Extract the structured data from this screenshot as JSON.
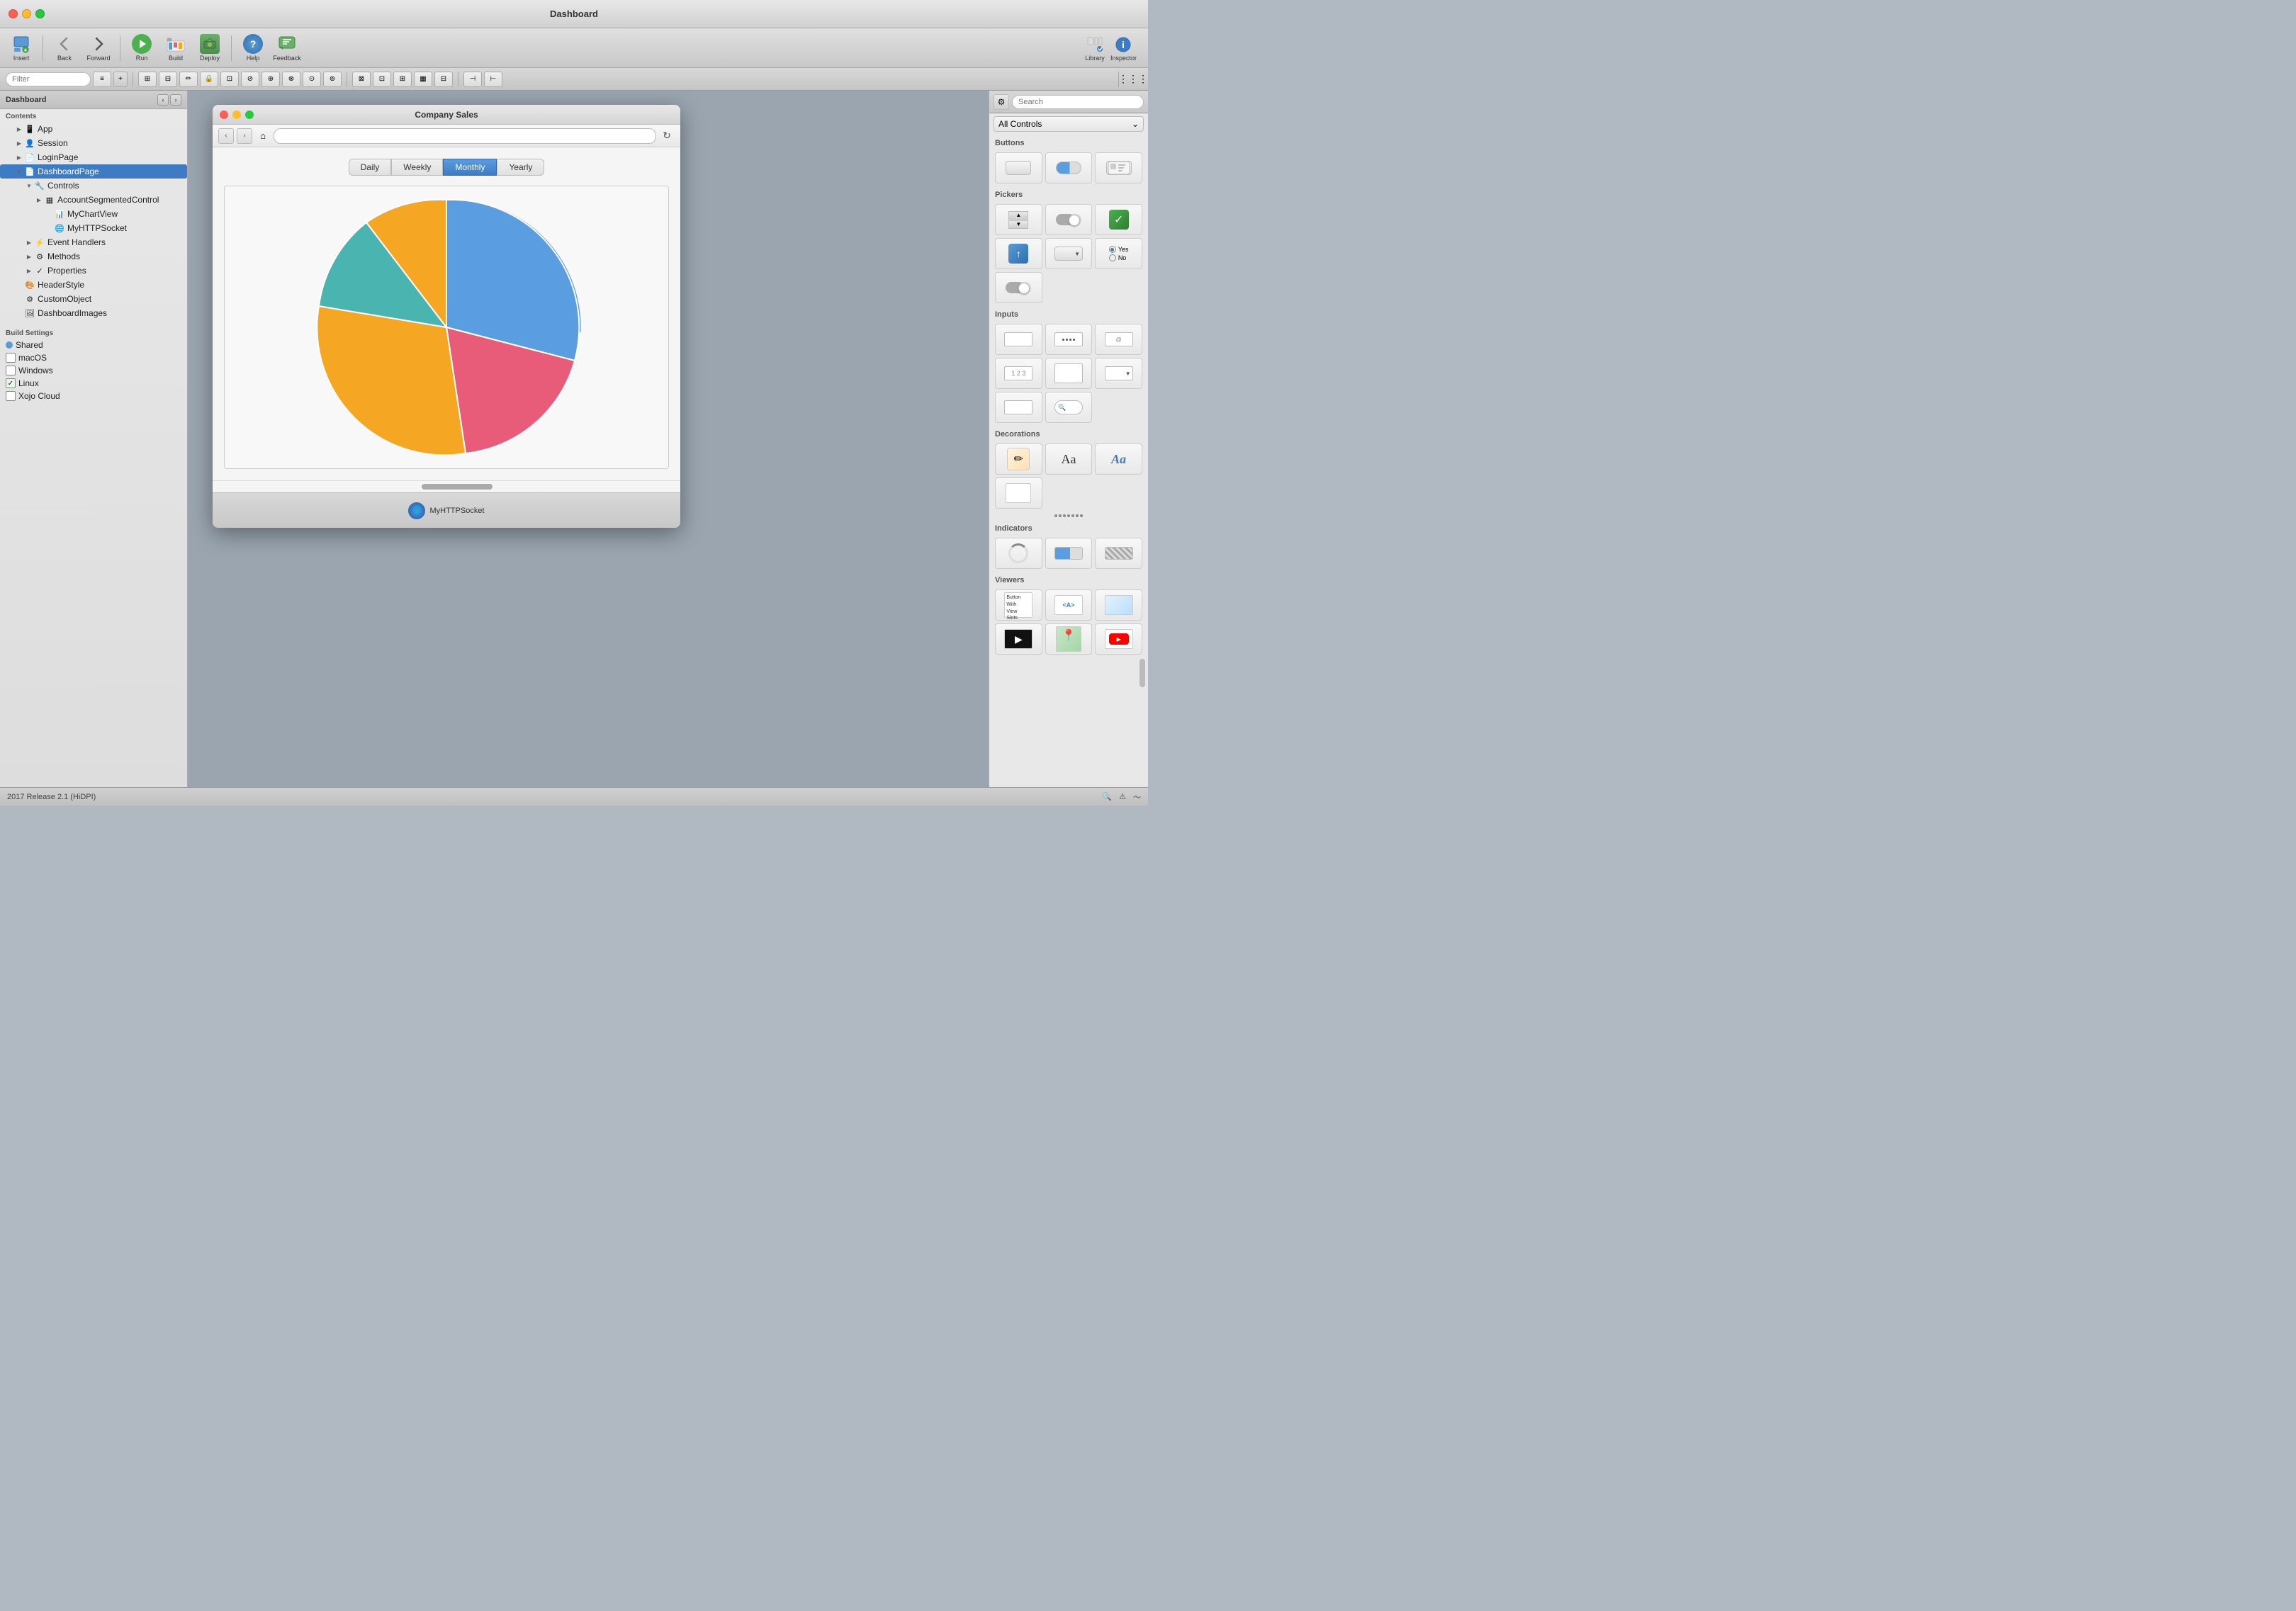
{
  "window": {
    "title": "Dashboard",
    "app_title": "Company Sales"
  },
  "toolbar": {
    "insert_label": "Insert",
    "back_label": "Back",
    "forward_label": "Forward",
    "run_label": "Run",
    "build_label": "Build",
    "deploy_label": "Deploy",
    "help_label": "Help",
    "feedback_label": "Feedback",
    "library_label": "Library",
    "inspector_label": "Inspector"
  },
  "filter": {
    "placeholder": "Filter"
  },
  "sidebar": {
    "project_name": "Dashboard",
    "section_contents": "Contents",
    "items": [
      {
        "label": "App",
        "icon": "📱",
        "indent": "indent1",
        "toggle": "closed"
      },
      {
        "label": "Session",
        "icon": "👤",
        "indent": "indent1",
        "toggle": "closed"
      },
      {
        "label": "LoginPage",
        "icon": "📄",
        "indent": "indent1",
        "toggle": "closed"
      },
      {
        "label": "DashboardPage",
        "icon": "📄",
        "indent": "indent1",
        "toggle": "open",
        "selected": true
      },
      {
        "label": "Controls",
        "icon": "🔧",
        "indent": "indent2",
        "toggle": "open"
      },
      {
        "label": "AccountSegmentedControl",
        "icon": "▦",
        "indent": "indent3",
        "toggle": "closed"
      },
      {
        "label": "MyChartView",
        "icon": "📊",
        "indent": "indent4",
        "toggle": "empty"
      },
      {
        "label": "MyHTTPSocket",
        "icon": "🌐",
        "indent": "indent4",
        "toggle": "empty"
      },
      {
        "label": "Event Handlers",
        "icon": "⚡",
        "indent": "indent2",
        "toggle": "closed"
      },
      {
        "label": "Methods",
        "icon": "⚙",
        "indent": "indent2",
        "toggle": "closed"
      },
      {
        "label": "Properties",
        "icon": "✓",
        "indent": "indent2",
        "toggle": "closed"
      },
      {
        "label": "HeaderStyle",
        "icon": "🎨",
        "indent": "indent1",
        "toggle": "empty"
      },
      {
        "label": "CustomObject",
        "icon": "⚙",
        "indent": "indent1",
        "toggle": "empty"
      },
      {
        "label": "DashboardImages",
        "icon": "🖼",
        "indent": "indent1",
        "toggle": "empty"
      }
    ],
    "section_build": "Build Settings",
    "build_items": [
      {
        "label": "Shared",
        "type": "dot",
        "color": "#5b9bd5",
        "checked": false
      },
      {
        "label": "macOS",
        "type": "checkbox",
        "checked": false
      },
      {
        "label": "Windows",
        "type": "checkbox",
        "checked": false
      },
      {
        "label": "Linux",
        "type": "checkbox",
        "checked": true
      },
      {
        "label": "Xojo Cloud",
        "type": "checkbox",
        "checked": false
      }
    ]
  },
  "app_window": {
    "nav_buttons": [
      "←",
      "→",
      "⌂"
    ],
    "segmented": {
      "buttons": [
        "Daily",
        "Weekly",
        "Monthly",
        "Yearly"
      ],
      "active": "Monthly"
    },
    "bottom_label": "MyHTTPSocket",
    "chart": {
      "slices": [
        {
          "color": "#5a9de0",
          "percent": 30,
          "start": 0,
          "end": 30
        },
        {
          "color": "#e85c7a",
          "percent": 22,
          "start": 30,
          "end": 52
        },
        {
          "color": "#f5a623",
          "percent": 31,
          "start": 52,
          "end": 83
        },
        {
          "color": "#f5a623",
          "percent": 10,
          "start": 83,
          "end": 93
        },
        {
          "color": "#4ab5b0",
          "percent": 7,
          "start": 93,
          "end": 100
        }
      ]
    }
  },
  "right_panel": {
    "search_placeholder": "Search",
    "dropdown_label": "All Controls",
    "sections": {
      "buttons_title": "Buttons",
      "pickers_title": "Pickers",
      "inputs_title": "Inputs",
      "decorations_title": "Decorations",
      "indicators_title": "Indicators",
      "viewers_title": "Viewers"
    },
    "radio_yes": "Yes",
    "radio_no": "No"
  },
  "status_bar": {
    "version": "2017 Release 2.1 (HiDPI)"
  }
}
